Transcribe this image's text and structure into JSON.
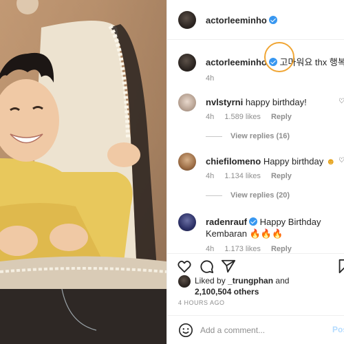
{
  "header": {
    "username": "actorleeminho"
  },
  "caption": {
    "username": "actorleeminho",
    "text": "고마워요 thx 행복해",
    "time": "4h"
  },
  "comments": [
    {
      "username": "nvlstyrni",
      "verified": false,
      "text": "happy birthday!",
      "time": "4h",
      "likes": "1.589 likes",
      "reply": "Reply",
      "view_replies": "View replies (16)"
    },
    {
      "username": "chiefilomeno",
      "verified": false,
      "text": "Happy birthday",
      "time": "4h",
      "likes": "1.134 likes",
      "reply": "Reply",
      "view_replies": "View replies (20)"
    },
    {
      "username": "radenrauf",
      "verified": true,
      "text_line1": "Happy Birthday",
      "text_line2": "Kembaran",
      "emoji": "🔥🔥🔥",
      "time": "4h",
      "likes": "1.173 likes",
      "reply": "Reply"
    }
  ],
  "likes": {
    "prefix": "Liked by",
    "by": "_trungphan",
    "and": "and",
    "count": "2,100,504 others"
  },
  "time_ago": "4 HOURS AGO",
  "add_comment": {
    "placeholder": "Add a comment...",
    "post_label": "Post"
  },
  "icons": {
    "like": "heart-outline-icon",
    "comment": "comment-bubble-icon",
    "share": "paper-plane-icon",
    "save": "bookmark-icon",
    "emoji": "smiley-icon"
  },
  "colors": {
    "verified": "#3897f0",
    "highlight_ring": "#f0a533",
    "muted_text": "#8e8e8e",
    "post_button_disabled": "#b3dbff"
  }
}
